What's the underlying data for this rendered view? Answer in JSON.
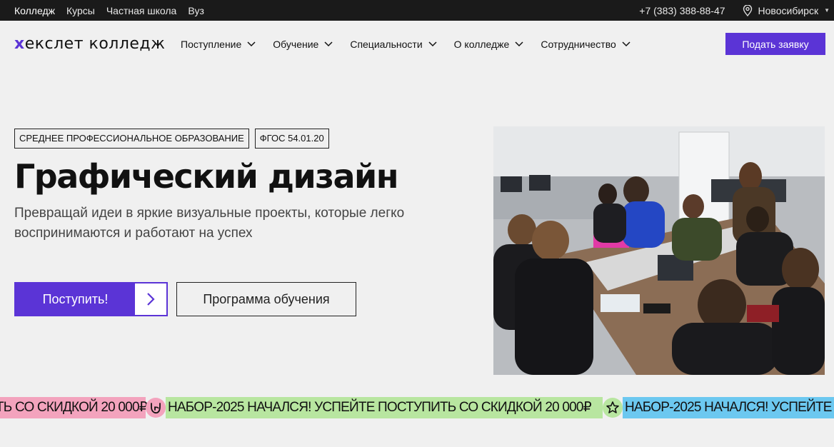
{
  "topbar": {
    "links": [
      "Колледж",
      "Курсы",
      "Частная школа",
      "Вуз"
    ],
    "phone": "+7 (383) 388-88-47",
    "city": "Новосибирск"
  },
  "header": {
    "logo_x": "х",
    "logo_rest": "екслет колледж",
    "nav": [
      "Поступление",
      "Обучение",
      "Специальности",
      "О колледже",
      "Сотрудничество"
    ],
    "apply_label": "Подать заявку"
  },
  "hero": {
    "badges": [
      "СРЕДНЕЕ ПРОФЕССИОНАЛЬНОЕ ОБРАЗОВАНИЕ",
      "ФГОС 54.01.20"
    ],
    "title": "Графический дизайн",
    "subtitle": "Превращай идеи в яркие визуальные проекты, которые легко воспринимаются и работают на успех",
    "enroll_label": "Поступить!",
    "program_label": "Программа обучения"
  },
  "ticker": {
    "text_start": "ТЬ СО СКИДКОЙ 20 000₽",
    "text_full": "НАБОР-2025 НАЧАЛСЯ! УСПЕЙТЕ ПОСТУПИТЬ СО СКИДКОЙ 20 000₽",
    "text_end": "НАБОР-2025 НАЧАЛСЯ! УСПЕЙТЕ",
    "colors": {
      "pink": "#f3a3bd",
      "green": "#b8e6a0",
      "blue": "#6cc8f0"
    },
    "icons": [
      "rock-hand-icon",
      "star-icon"
    ]
  },
  "colors": {
    "accent": "#5b34d6",
    "topbar": "#1a1a1a",
    "background": "#f0f0f0"
  }
}
